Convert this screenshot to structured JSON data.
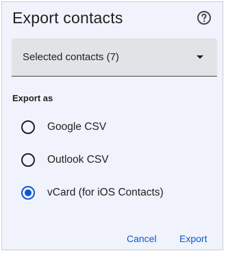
{
  "dialog": {
    "title": "Export contacts",
    "help_icon": "help-circle-icon"
  },
  "select": {
    "value": "Selected contacts (7)",
    "arrow_icon": "dropdown-arrow-icon"
  },
  "export_as": {
    "label": "Export as",
    "options": [
      {
        "label": "Google CSV",
        "checked": false
      },
      {
        "label": "Outlook CSV",
        "checked": false
      },
      {
        "label": "vCard (for iOS Contacts)",
        "checked": true
      }
    ]
  },
  "actions": {
    "cancel": "Cancel",
    "export": "Export"
  },
  "colors": {
    "accent": "#0b57d0",
    "dialog_bg": "#f0f3fb",
    "select_bg": "#e1e3e6"
  }
}
